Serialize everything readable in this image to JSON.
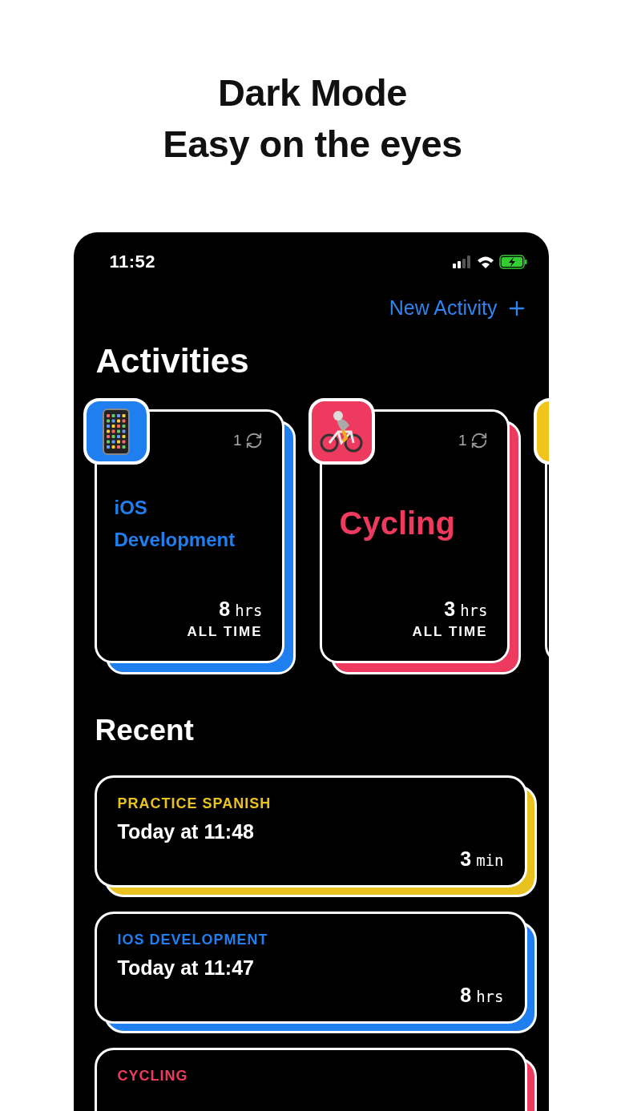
{
  "headline": [
    "Dark Mode",
    "Easy on the eyes"
  ],
  "status_bar": {
    "time": "11:52"
  },
  "new_activity": {
    "label": "New Activity"
  },
  "activities_title": "Activities",
  "activities": [
    {
      "kind": "phone",
      "title": "iOS Development",
      "count": "1",
      "total_value": "8",
      "total_unit": "hrs",
      "total_label": "ALL TIME",
      "color": "#1f7ff0"
    },
    {
      "kind": "bike",
      "title": "Cycling",
      "count": "1",
      "total_value": "3",
      "total_unit": "hrs",
      "total_label": "ALL TIME",
      "color": "#ee3a5e"
    },
    {
      "kind": "blank",
      "color": "#f0c419"
    }
  ],
  "recent_title": "Recent",
  "recent": [
    {
      "activity": "PRACTICE SPANISH",
      "time": "Today at 11:48",
      "value": "3",
      "unit": "min",
      "color": "#e9c21f"
    },
    {
      "activity": "IOS DEVELOPMENT",
      "time": "Today at 11:47",
      "value": "8",
      "unit": "hrs",
      "color": "#1f7ff0"
    },
    {
      "activity": "CYCLING",
      "color": "#ee3a5e"
    }
  ]
}
